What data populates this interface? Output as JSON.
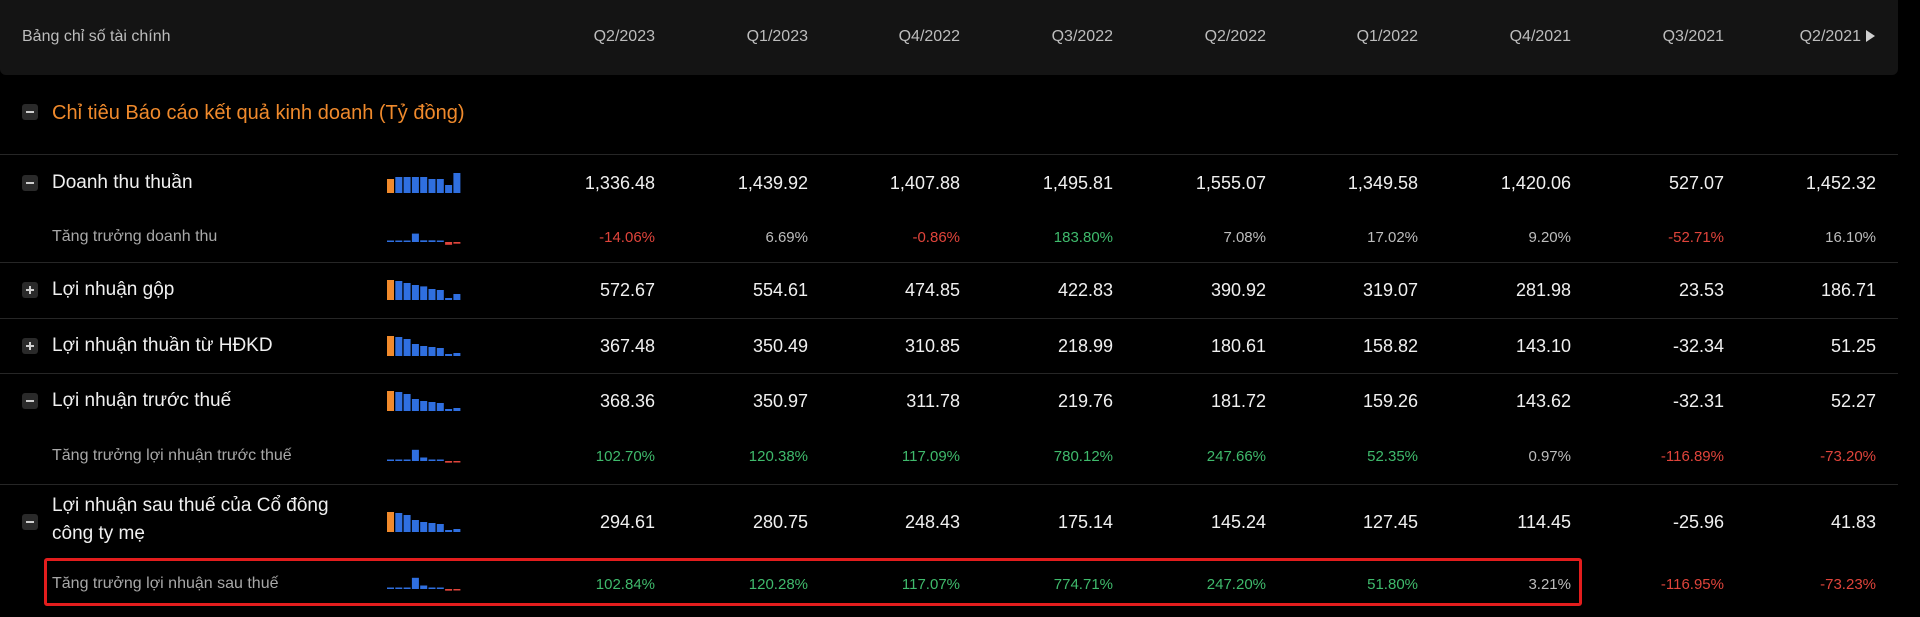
{
  "header": {
    "title": "Bảng chỉ số tài chính",
    "periods": [
      "Q2/2023",
      "Q1/2023",
      "Q4/2022",
      "Q3/2022",
      "Q2/2022",
      "Q1/2022",
      "Q4/2021",
      "Q3/2021",
      "Q2/2021"
    ]
  },
  "section": {
    "title": "Chỉ tiêu Báo cáo kết quả kinh doanh (Tỷ đồng)"
  },
  "colors": {
    "accent_orange": "#f08a2c",
    "bar_blue": "#2f6fe0",
    "positive": "#3fba6c",
    "negative": "#e0443b",
    "highlight": "#e31d1d"
  },
  "rows": [
    {
      "label": "Doanh thu thuần",
      "kind": "main",
      "toggle": "minus",
      "values": [
        "1,336.48",
        "1,439.92",
        "1,407.88",
        "1,495.81",
        "1,555.07",
        "1,349.58",
        "1,420.06",
        "527.07",
        "1,452.32"
      ]
    },
    {
      "label": "Tăng trưởng doanh thu",
      "kind": "sub",
      "values": [
        "-14.06%",
        "6.69%",
        "-0.86%",
        "183.80%",
        "7.08%",
        "17.02%",
        "9.20%",
        "-52.71%",
        "16.10%"
      ],
      "tones": [
        "neg",
        "neu",
        "neg",
        "pos",
        "neu",
        "neu",
        "neu",
        "neg",
        "neu"
      ]
    },
    {
      "label": "Lợi nhuận gộp",
      "kind": "main",
      "toggle": "plus",
      "values": [
        "572.67",
        "554.61",
        "474.85",
        "422.83",
        "390.92",
        "319.07",
        "281.98",
        "23.53",
        "186.71"
      ]
    },
    {
      "label": "Lợi nhuận thuần từ HĐKD",
      "kind": "main",
      "toggle": "plus",
      "values": [
        "367.48",
        "350.49",
        "310.85",
        "218.99",
        "180.61",
        "158.82",
        "143.10",
        "-32.34",
        "51.25"
      ]
    },
    {
      "label": "Lợi nhuận trước thuế",
      "kind": "main",
      "toggle": "minus",
      "values": [
        "368.36",
        "350.97",
        "311.78",
        "219.76",
        "181.72",
        "159.26",
        "143.62",
        "-32.31",
        "52.27"
      ]
    },
    {
      "label": "Tăng trưởng lợi nhuận trước thuế",
      "kind": "sub",
      "values": [
        "102.70%",
        "120.38%",
        "117.09%",
        "780.12%",
        "247.66%",
        "52.35%",
        "0.97%",
        "-116.89%",
        "-73.20%"
      ],
      "tones": [
        "pos",
        "pos",
        "pos",
        "pos",
        "pos",
        "pos",
        "neu",
        "neg",
        "neg"
      ]
    },
    {
      "label_line1": "Lợi nhuận sau thuế của Cổ đông",
      "label_line2": "công ty mẹ",
      "kind": "main2",
      "toggle": "minus",
      "values": [
        "294.61",
        "280.75",
        "248.43",
        "175.14",
        "145.24",
        "127.45",
        "114.45",
        "-25.96",
        "41.83"
      ]
    },
    {
      "label": "Tăng trưởng lợi nhuận sau thuế",
      "kind": "sub",
      "values": [
        "102.84%",
        "120.28%",
        "117.07%",
        "774.71%",
        "247.20%",
        "51.80%",
        "3.21%",
        "-116.95%",
        "-73.23%"
      ],
      "tones": [
        "pos",
        "pos",
        "pos",
        "pos",
        "pos",
        "pos",
        "neu",
        "neg",
        "neg"
      ]
    }
  ]
}
